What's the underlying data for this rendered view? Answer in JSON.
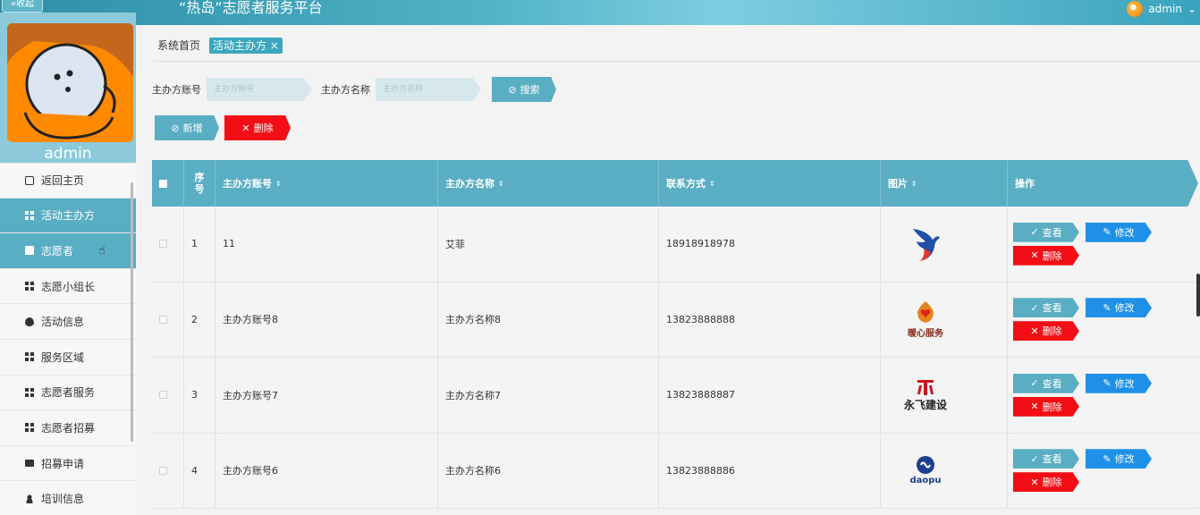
{
  "header": {
    "collapse_label": "«收起",
    "title": "“热岛”志愿者服务平台",
    "user_label": "admin"
  },
  "sidebar": {
    "username": "admin",
    "items": [
      {
        "label": "返回主页",
        "icon": "home-icon"
      },
      {
        "label": "活动主办方",
        "icon": "grid-icon",
        "active": true
      },
      {
        "label": "志愿者",
        "icon": "book-icon",
        "active": true
      },
      {
        "label": "志愿小组长",
        "icon": "grid-icon"
      },
      {
        "label": "活动信息",
        "icon": "pin-icon"
      },
      {
        "label": "服务区域",
        "icon": "grid-icon"
      },
      {
        "label": "志愿者服务",
        "icon": "grid-icon"
      },
      {
        "label": "志愿者招募",
        "icon": "grid-icon"
      },
      {
        "label": "招募申请",
        "icon": "print-icon"
      },
      {
        "label": "培训信息",
        "icon": "user-icon"
      }
    ]
  },
  "tabs": [
    {
      "label": "系统首页"
    },
    {
      "label": "活动主办方 ×",
      "active": true
    }
  ],
  "search": {
    "account_label": "主办方账号",
    "account_placeholder": "主办方账号",
    "name_label": "主办方名称",
    "name_placeholder": "主办方名称",
    "search_button": "搜索"
  },
  "actions": {
    "add_label": "新增",
    "delete_label": "删除"
  },
  "table": {
    "columns": [
      "序号",
      "主办方账号",
      "主办方名称",
      "联系方式",
      "图片",
      "操作"
    ],
    "rows": [
      {
        "index": "1",
        "account": "11",
        "name": "艾菲",
        "contact": "18918918978",
        "logo": "eagle-logo",
        "logo_text": ""
      },
      {
        "index": "2",
        "account": "主办方账号8",
        "name": "主办方名称8",
        "contact": "13823888888",
        "logo": "heart-logo",
        "logo_text": "暖心服务"
      },
      {
        "index": "3",
        "account": "主办方账号7",
        "name": "主办方名称7",
        "contact": "13823888887",
        "logo": "building-logo",
        "logo_text": "永飞建设"
      },
      {
        "index": "4",
        "account": "主办方账号6",
        "name": "主办方名称6",
        "contact": "13823888886",
        "logo": "daopu-logo",
        "logo_text": "daopu"
      }
    ],
    "op_view": "查看",
    "op_edit": "修改",
    "op_delete": "删除"
  }
}
